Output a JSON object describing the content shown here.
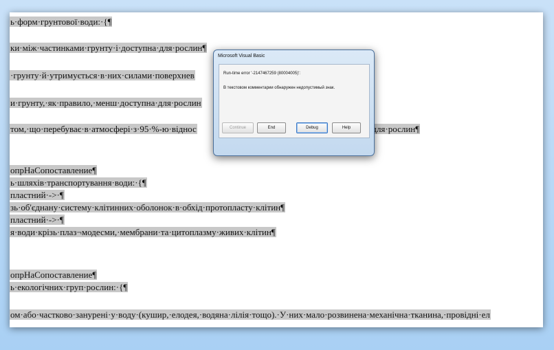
{
  "document": {
    "lines": [
      "ь·форм·грунтової·води:·{¶",
      "ки·між·частинками·грунту·і·доступна·для·рослин¶",
      "·грунту·й·утримується·в·них·силами·поверхнев",
      "и·грунту,·як·правило,·менш·доступна·для·рослин",
      "том,·що·перебуває·в·атмосфері·з·95·%-ю·віднос",
      "·для·рослин¶",
      "опрНаСопоставление¶",
      "ь·шляхів·транспортування·води:·{¶",
      "пластний·->·¶",
      "зь·об'єднану·систему·клітинних·оболонок·в·обхід·протопласту·клітин¶",
      "пластний·->·¶",
      "я·води·крізь·плаз¬модесми,·мембрани·та·цитоплазму·живих·клітин¶",
      "опрНаСопоставление¶",
      "ь·екологічних·груп·рослин:·{¶",
      "ом·або·частково·занурені·у·воду·(кушир,·елодея,·водяна·лілія·тощо).·У·них·мало·розвинена·механічна·тканина,·провідні·ел"
    ]
  },
  "dialog": {
    "title": "Microsoft Visual Basic",
    "error_line": "Run-time error '-2147467259 (80004005)':",
    "message": "В текстовом комментарии обнаружен недопустимый знак.",
    "buttons": {
      "continue": "Continue",
      "end": "End",
      "debug": "Debug",
      "help": "Help"
    }
  }
}
